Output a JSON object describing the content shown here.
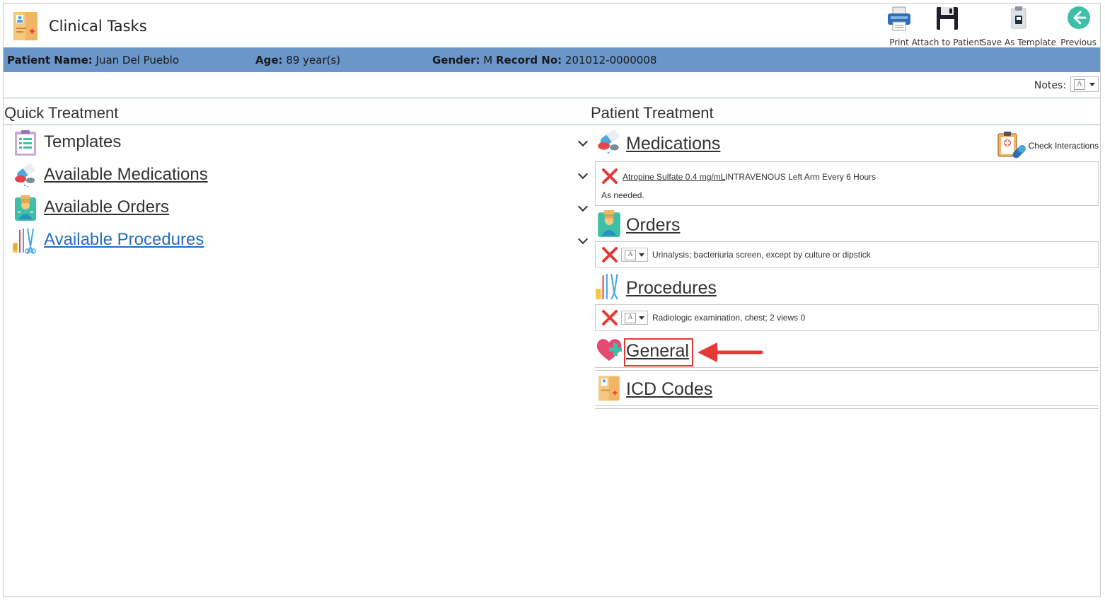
{
  "header": {
    "title": "Clinical Tasks",
    "toolbar": {
      "print": "Print",
      "attach": "Attach to Patient",
      "save_template": "Save As Template",
      "previous": "Previous"
    }
  },
  "patient": {
    "name_label": "Patient Name:",
    "name": "Juan Del Pueblo",
    "age_label": "Age:",
    "age": "89 year(s)",
    "gender_label": "Gender:",
    "gender": "M",
    "record_label": "Record No:",
    "record": "201012-0000008"
  },
  "notes": {
    "label": "Notes:"
  },
  "quick_treatment": {
    "title": "Quick Treatment",
    "items": [
      {
        "label": "Templates",
        "icon": "clipboard-list-icon"
      },
      {
        "label": "Available Medications",
        "icon": "pills-icon"
      },
      {
        "label": "Available Orders",
        "icon": "doctor-clipboard-icon"
      },
      {
        "label": "Available Procedures",
        "icon": "surgical-tools-icon"
      }
    ]
  },
  "patient_treatment": {
    "title": "Patient Treatment",
    "check_interactions": "Check Interactions",
    "medications": {
      "label": "Medications",
      "rows": [
        {
          "drug": "Atropine Sulfate  0.4 mg/mL",
          "details": "INTRAVENOUS Left Arm Every 6 Hours",
          "note": "As needed."
        }
      ]
    },
    "orders": {
      "label": "Orders",
      "rows": [
        {
          "text": "Urinalysis; bacteriuria screen, except by culture or dipstick"
        }
      ]
    },
    "procedures": {
      "label": "Procedures",
      "rows": [
        {
          "text": "Radiologic examination, chest; 2 views 0"
        }
      ]
    },
    "general": {
      "label": "General"
    },
    "icd": {
      "label": "ICD Codes"
    }
  },
  "colors": {
    "patient_bar": "#6b96c9",
    "link_blue": "#1f6fc1",
    "remove_red": "#e53935",
    "highlight": "#e53935"
  }
}
